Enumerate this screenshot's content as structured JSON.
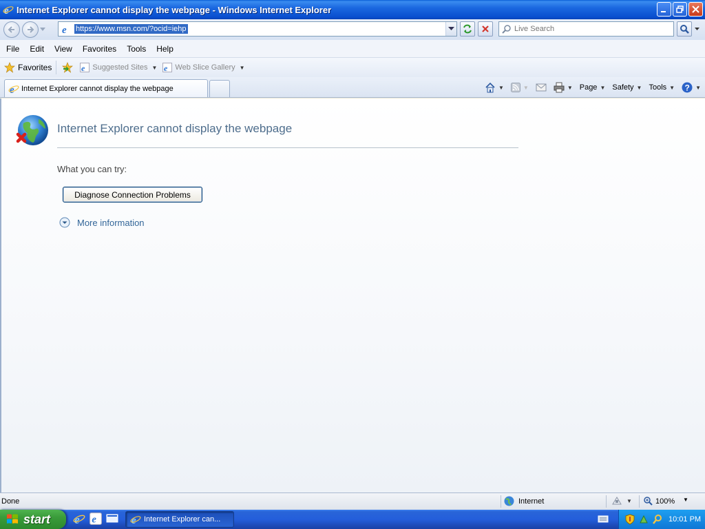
{
  "window": {
    "title": "Internet Explorer cannot display the webpage - Windows Internet Explorer"
  },
  "address_bar": {
    "url": "https://www.msn.com/?ocid=iehp"
  },
  "search": {
    "placeholder": "Live Search"
  },
  "menu": {
    "items": [
      "File",
      "Edit",
      "View",
      "Favorites",
      "Tools",
      "Help"
    ]
  },
  "favorites_bar": {
    "favorites_label": "Favorites",
    "links": [
      "Suggested Sites",
      "Web Slice Gallery"
    ]
  },
  "tabs": {
    "active": "Internet Explorer cannot display the webpage"
  },
  "command_bar": {
    "page": "Page",
    "safety": "Safety",
    "tools": "Tools"
  },
  "content": {
    "title": "Internet Explorer cannot display the webpage",
    "try_text": "What you can try:",
    "diagnose_button": "Diagnose Connection Problems",
    "more_info": "More information"
  },
  "status_bar": {
    "status": "Done",
    "zone": "Internet",
    "zoom": "100%"
  },
  "taskbar": {
    "start": "start",
    "task_label": "Internet Explorer can...",
    "clock": "10:01 PM"
  },
  "colors": {
    "title_bar": "#1b68e0",
    "content_title": "#4e6d8c",
    "link": "#336699",
    "start_button": "#3a9b3a",
    "selection": "#316ac5"
  }
}
